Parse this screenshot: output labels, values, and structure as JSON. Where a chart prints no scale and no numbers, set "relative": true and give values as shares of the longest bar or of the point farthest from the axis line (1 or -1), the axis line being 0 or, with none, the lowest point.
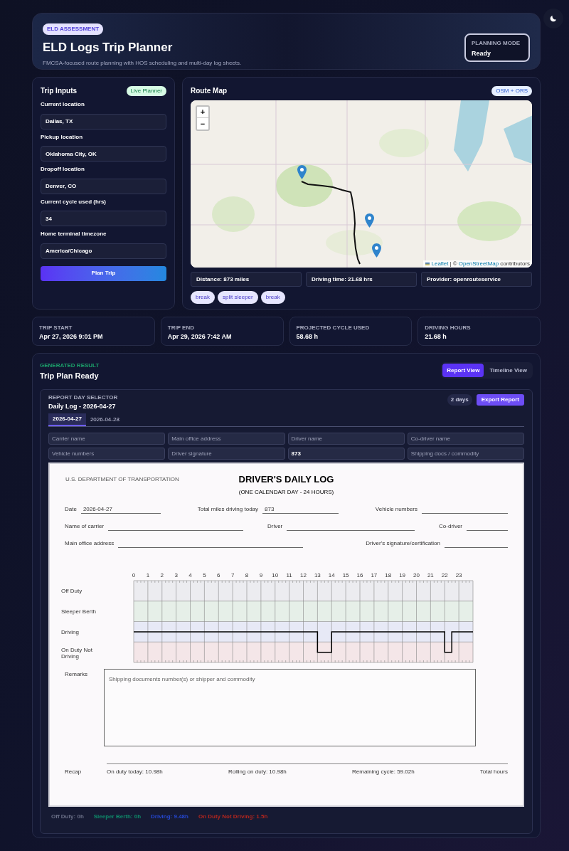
{
  "header": {
    "badge": "ELD ASSESSMENT",
    "title": "ELD Logs Trip Planner",
    "subtitle": "FMCSA-focused route planning with HOS scheduling and multi-day log sheets.",
    "mode_label": "PLANNING MODE",
    "mode_value": "Ready"
  },
  "inputs": {
    "title": "Trip Inputs",
    "badge": "Live Planner",
    "fields": [
      {
        "label": "Current location",
        "value": "Dallas, TX"
      },
      {
        "label": "Pickup location",
        "value": "Oklahoma City, OK"
      },
      {
        "label": "Dropoff location",
        "value": "Denver, CO"
      },
      {
        "label": "Current cycle used (hrs)",
        "value": "34"
      },
      {
        "label": "Home terminal timezone",
        "value": "America/Chicago"
      }
    ],
    "button": "Plan Trip"
  },
  "map": {
    "title": "Route Map",
    "badge": "OSM + ORS",
    "zoom_in": "+",
    "zoom_out": "−",
    "attribution_link": "Leaflet",
    "attribution_sep": "| ©",
    "attribution_osm": "OpenStreetMap",
    "attribution_rest": "contributors",
    "stats": [
      "Distance: 873 miles",
      "Driving time: 21.68 hrs",
      "Provider: openrouteservice"
    ],
    "tags": [
      "break",
      "split sleeper",
      "break"
    ]
  },
  "summary": [
    {
      "label": "TRIP START",
      "value": "Apr 27, 2026 9:01 PM"
    },
    {
      "label": "TRIP END",
      "value": "Apr 29, 2026 7:42 AM"
    },
    {
      "label": "PROJECTED CYCLE USED",
      "value": "58.68 h"
    },
    {
      "label": "DRIVING HOURS",
      "value": "21.68 h"
    }
  ],
  "result": {
    "eyebrow": "GENERATED RESULT",
    "title": "Trip Plan Ready",
    "views": [
      {
        "label": "Report View",
        "selected": true
      },
      {
        "label": "Timeline View",
        "selected": false
      }
    ]
  },
  "report": {
    "eyebrow": "REPORT DAY SELECTOR",
    "title": "Daily Log - 2026-04-27",
    "days_badge": "2 days",
    "export": "Export Report",
    "tabs": [
      {
        "label": "2026-04-27",
        "selected": true
      },
      {
        "label": "2026-04-28",
        "selected": false
      }
    ],
    "fields": [
      {
        "placeholder": "Carrier name"
      },
      {
        "placeholder": "Main office address"
      },
      {
        "placeholder": "Driver name"
      },
      {
        "placeholder": "Co-driver name"
      },
      {
        "placeholder": "Vehicle numbers"
      },
      {
        "placeholder": "Driver signature"
      },
      {
        "value": "873"
      },
      {
        "placeholder": "Shipping docs / commodity"
      }
    ]
  },
  "log": {
    "agency": "U.S. DEPARTMENT OF TRANSPORTATION",
    "title": "DRIVER'S DAILY LOG",
    "subtitle": "(ONE CALENDAR DAY - 24 HOURS)",
    "row1": [
      {
        "label": "Date",
        "value": "2026-04-27"
      },
      {
        "label": "Total miles driving today",
        "value": "873"
      },
      {
        "label": "Vehicle numbers"
      }
    ],
    "row2": [
      {
        "label": "Name of carrier"
      },
      {
        "label": "Driver"
      },
      {
        "label": "Co-driver"
      }
    ],
    "row3": [
      {
        "label": "Main office address"
      },
      {
        "label": "Driver's signature/certification"
      }
    ],
    "chart_data": {
      "type": "line",
      "x": [
        0,
        13,
        13,
        14,
        14,
        22,
        22,
        22.5,
        22.5,
        24
      ],
      "series": [
        {
          "color": "#000000",
          "values": [
            1,
            1,
            0,
            0,
            1,
            1,
            0,
            0,
            1,
            1
          ]
        }
      ],
      "xlim": [
        0,
        24
      ],
      "relative": true,
      "grid": true,
      "bands": [
        {
          "axis": "y",
          "from": -0.5,
          "to": 0.5,
          "color": "#f4e6e8"
        },
        {
          "axis": "y",
          "from": 0.5,
          "to": 1.5,
          "color": "#e7e9f6"
        },
        {
          "axis": "y",
          "from": 1.5,
          "to": 2.5,
          "color": "#e6efe8"
        },
        {
          "axis": "y",
          "from": 2.5,
          "to": 3.5,
          "color": "#ececf0"
        }
      ],
      "xticks": [
        0,
        1,
        2,
        3,
        4,
        5,
        6,
        7,
        8,
        9,
        10,
        11,
        12,
        13,
        14,
        15,
        16,
        17,
        18,
        19,
        20,
        21,
        22,
        23
      ],
      "y_categories": [
        "On Duty Not Driving",
        "Driving",
        "Sleeper Berth",
        "Off Duty"
      ]
    },
    "remarks_label": "Remarks",
    "remarks_placeholder": "Shipping documents number(s) or shipper and commodity",
    "recap_label": "Recap",
    "recap": [
      "On duty today: 10.98h",
      "Rolling on duty: 10.98h",
      "Remaining cycle: 59.02h",
      "Total hours"
    ]
  },
  "legend": [
    {
      "label": "Off Duty: 0h",
      "color": "#6b7088"
    },
    {
      "label": "Sleeper Berth: 0h",
      "color": "#0f8a6a"
    },
    {
      "label": "Driving: 9.48h",
      "color": "#2547d0"
    },
    {
      "label": "On Duty Not Driving: 1.5h",
      "color": "#b3261e"
    }
  ]
}
